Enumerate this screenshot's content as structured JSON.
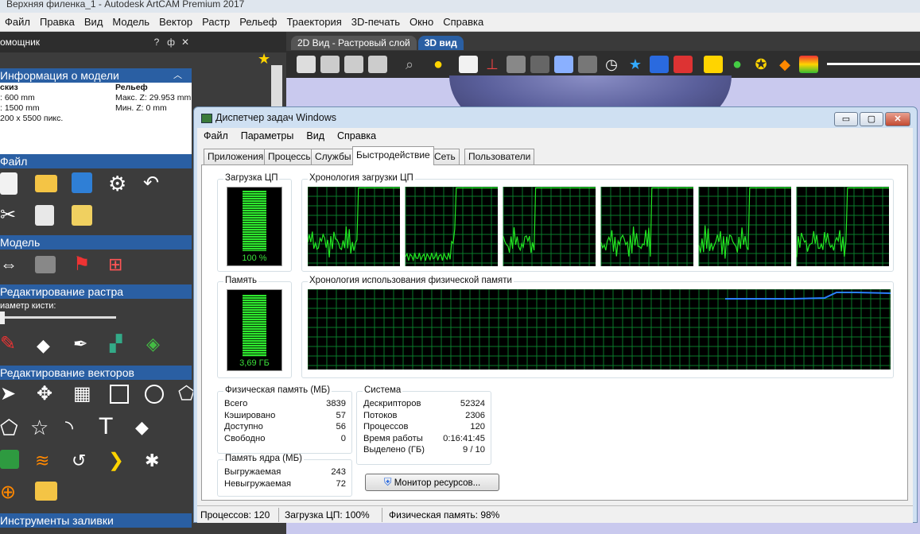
{
  "app": {
    "title": "Верхняя филенка_1 - Autodesk ArtCAM Premium 2017",
    "menu": [
      "Файл",
      "Правка",
      "Вид",
      "Модель",
      "Вектор",
      "Растр",
      "Рельеф",
      "Траектория",
      "3D-печать",
      "Окно",
      "Справка"
    ]
  },
  "assistant": {
    "title": "омощник",
    "buttons": [
      "?",
      "ф",
      "✕"
    ],
    "info_header": "Информация о модели",
    "col1_title": "скиз",
    "col1": [
      ": 600 mm",
      ": 1500 mm",
      "200 x 5500 пикс."
    ],
    "col2_title": "Рельеф",
    "col2": [
      "Макс. Z: 29.953 mm",
      "Мин. Z: 0 mm"
    ],
    "sections": {
      "file": "Файл",
      "model": "Модель",
      "raster": "Редактирование растра",
      "brush": "иаметр кисти:",
      "vectors": "Редактирование векторов",
      "fill": "Инструменты заливки"
    }
  },
  "view_tabs": [
    "2D Вид - Растровый слой",
    "3D вид"
  ],
  "taskmgr": {
    "title": "Диспетчер задач Windows",
    "menu": [
      "Файл",
      "Параметры",
      "Вид",
      "Справка"
    ],
    "tabs": [
      "Приложения",
      "Процессы",
      "Службы",
      "Быстродействие",
      "Сеть",
      "Пользователи"
    ],
    "active_tab": "Быстродействие",
    "cpu_label": "Загрузка ЦП",
    "cpu_value": "100 %",
    "cpu_fraction": 1.0,
    "cpu_history_label": "Хронология загрузки ЦП",
    "mem_label": "Память",
    "mem_value": "3,69 ГБ",
    "mem_fraction": 0.98,
    "mem_history_label": "Хронология использования физической памяти",
    "phys": {
      "title": "Физическая память (МБ)",
      "rows": [
        [
          "Всего",
          "3839"
        ],
        [
          "Кэшировано",
          "57"
        ],
        [
          "Доступно",
          "56"
        ],
        [
          "Свободно",
          "0"
        ]
      ]
    },
    "kernel": {
      "title": "Память ядра (МБ)",
      "rows": [
        [
          "Выгружаемая",
          "243"
        ],
        [
          "Невыгружаемая",
          "72"
        ]
      ]
    },
    "system": {
      "title": "Система",
      "rows": [
        [
          "Дескрипторов",
          "52324"
        ],
        [
          "Потоков",
          "2306"
        ],
        [
          "Процессов",
          "120"
        ],
        [
          "Время работы",
          "0:16:41:45"
        ],
        [
          "Выделено (ГБ)",
          "9 / 10"
        ]
      ]
    },
    "monitor_button": "Монитор ресурсов...",
    "status": [
      "Процессов: 120",
      "Загрузка ЦП: 100%",
      "Физическая память: 98%"
    ]
  },
  "colors": {
    "graph_line": "#22e822",
    "mem_line": "#2a7fff",
    "section": "#2a5fa3",
    "grid": "#0a7a2a"
  }
}
